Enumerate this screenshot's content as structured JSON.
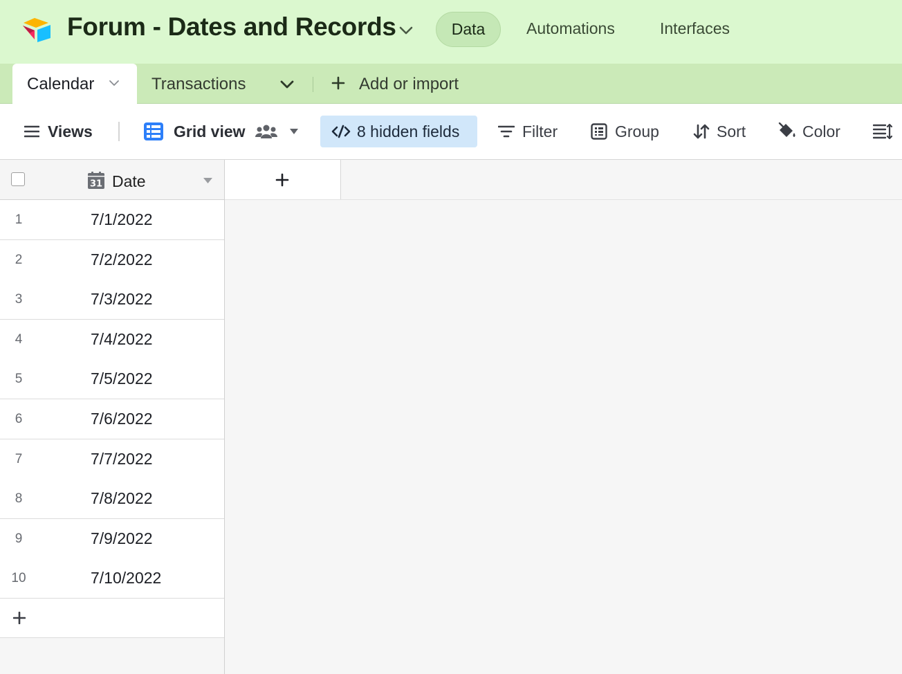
{
  "header": {
    "base_title": "Forum - Dates and Records",
    "logo_icon": "airtable-logo-icon",
    "nav": [
      {
        "label": "Data",
        "active": true
      },
      {
        "label": "Automations",
        "active": false
      },
      {
        "label": "Interfaces",
        "active": false
      }
    ],
    "colors": {
      "header_bg": "#dbf8cf",
      "tabbar_bg": "#cbeab8",
      "active_pill": "#c5e8b6"
    }
  },
  "tables": {
    "tabs": [
      {
        "label": "Calendar",
        "active": true
      },
      {
        "label": "Transactions",
        "active": false
      }
    ],
    "add_label": "Add or import"
  },
  "toolbar": {
    "views_label": "Views",
    "view_name": "Grid view",
    "hidden_fields_label": "8 hidden fields",
    "filter_label": "Filter",
    "group_label": "Group",
    "sort_label": "Sort",
    "color_label": "Color",
    "hidden_fields_bg": "#d1e7fa"
  },
  "grid": {
    "primary_field": {
      "name": "Date",
      "icon": "calendar-31-icon"
    },
    "rows": [
      {
        "num": "1",
        "date": "7/1/2022"
      },
      {
        "num": "2",
        "date": "7/2/2022"
      },
      {
        "num": "3",
        "date": "7/3/2022"
      },
      {
        "num": "4",
        "date": "7/4/2022"
      },
      {
        "num": "5",
        "date": "7/5/2022"
      },
      {
        "num": "6",
        "date": "7/6/2022"
      },
      {
        "num": "7",
        "date": "7/7/2022"
      },
      {
        "num": "8",
        "date": "7/8/2022"
      },
      {
        "num": "9",
        "date": "7/9/2022"
      },
      {
        "num": "10",
        "date": "7/10/2022"
      }
    ]
  }
}
